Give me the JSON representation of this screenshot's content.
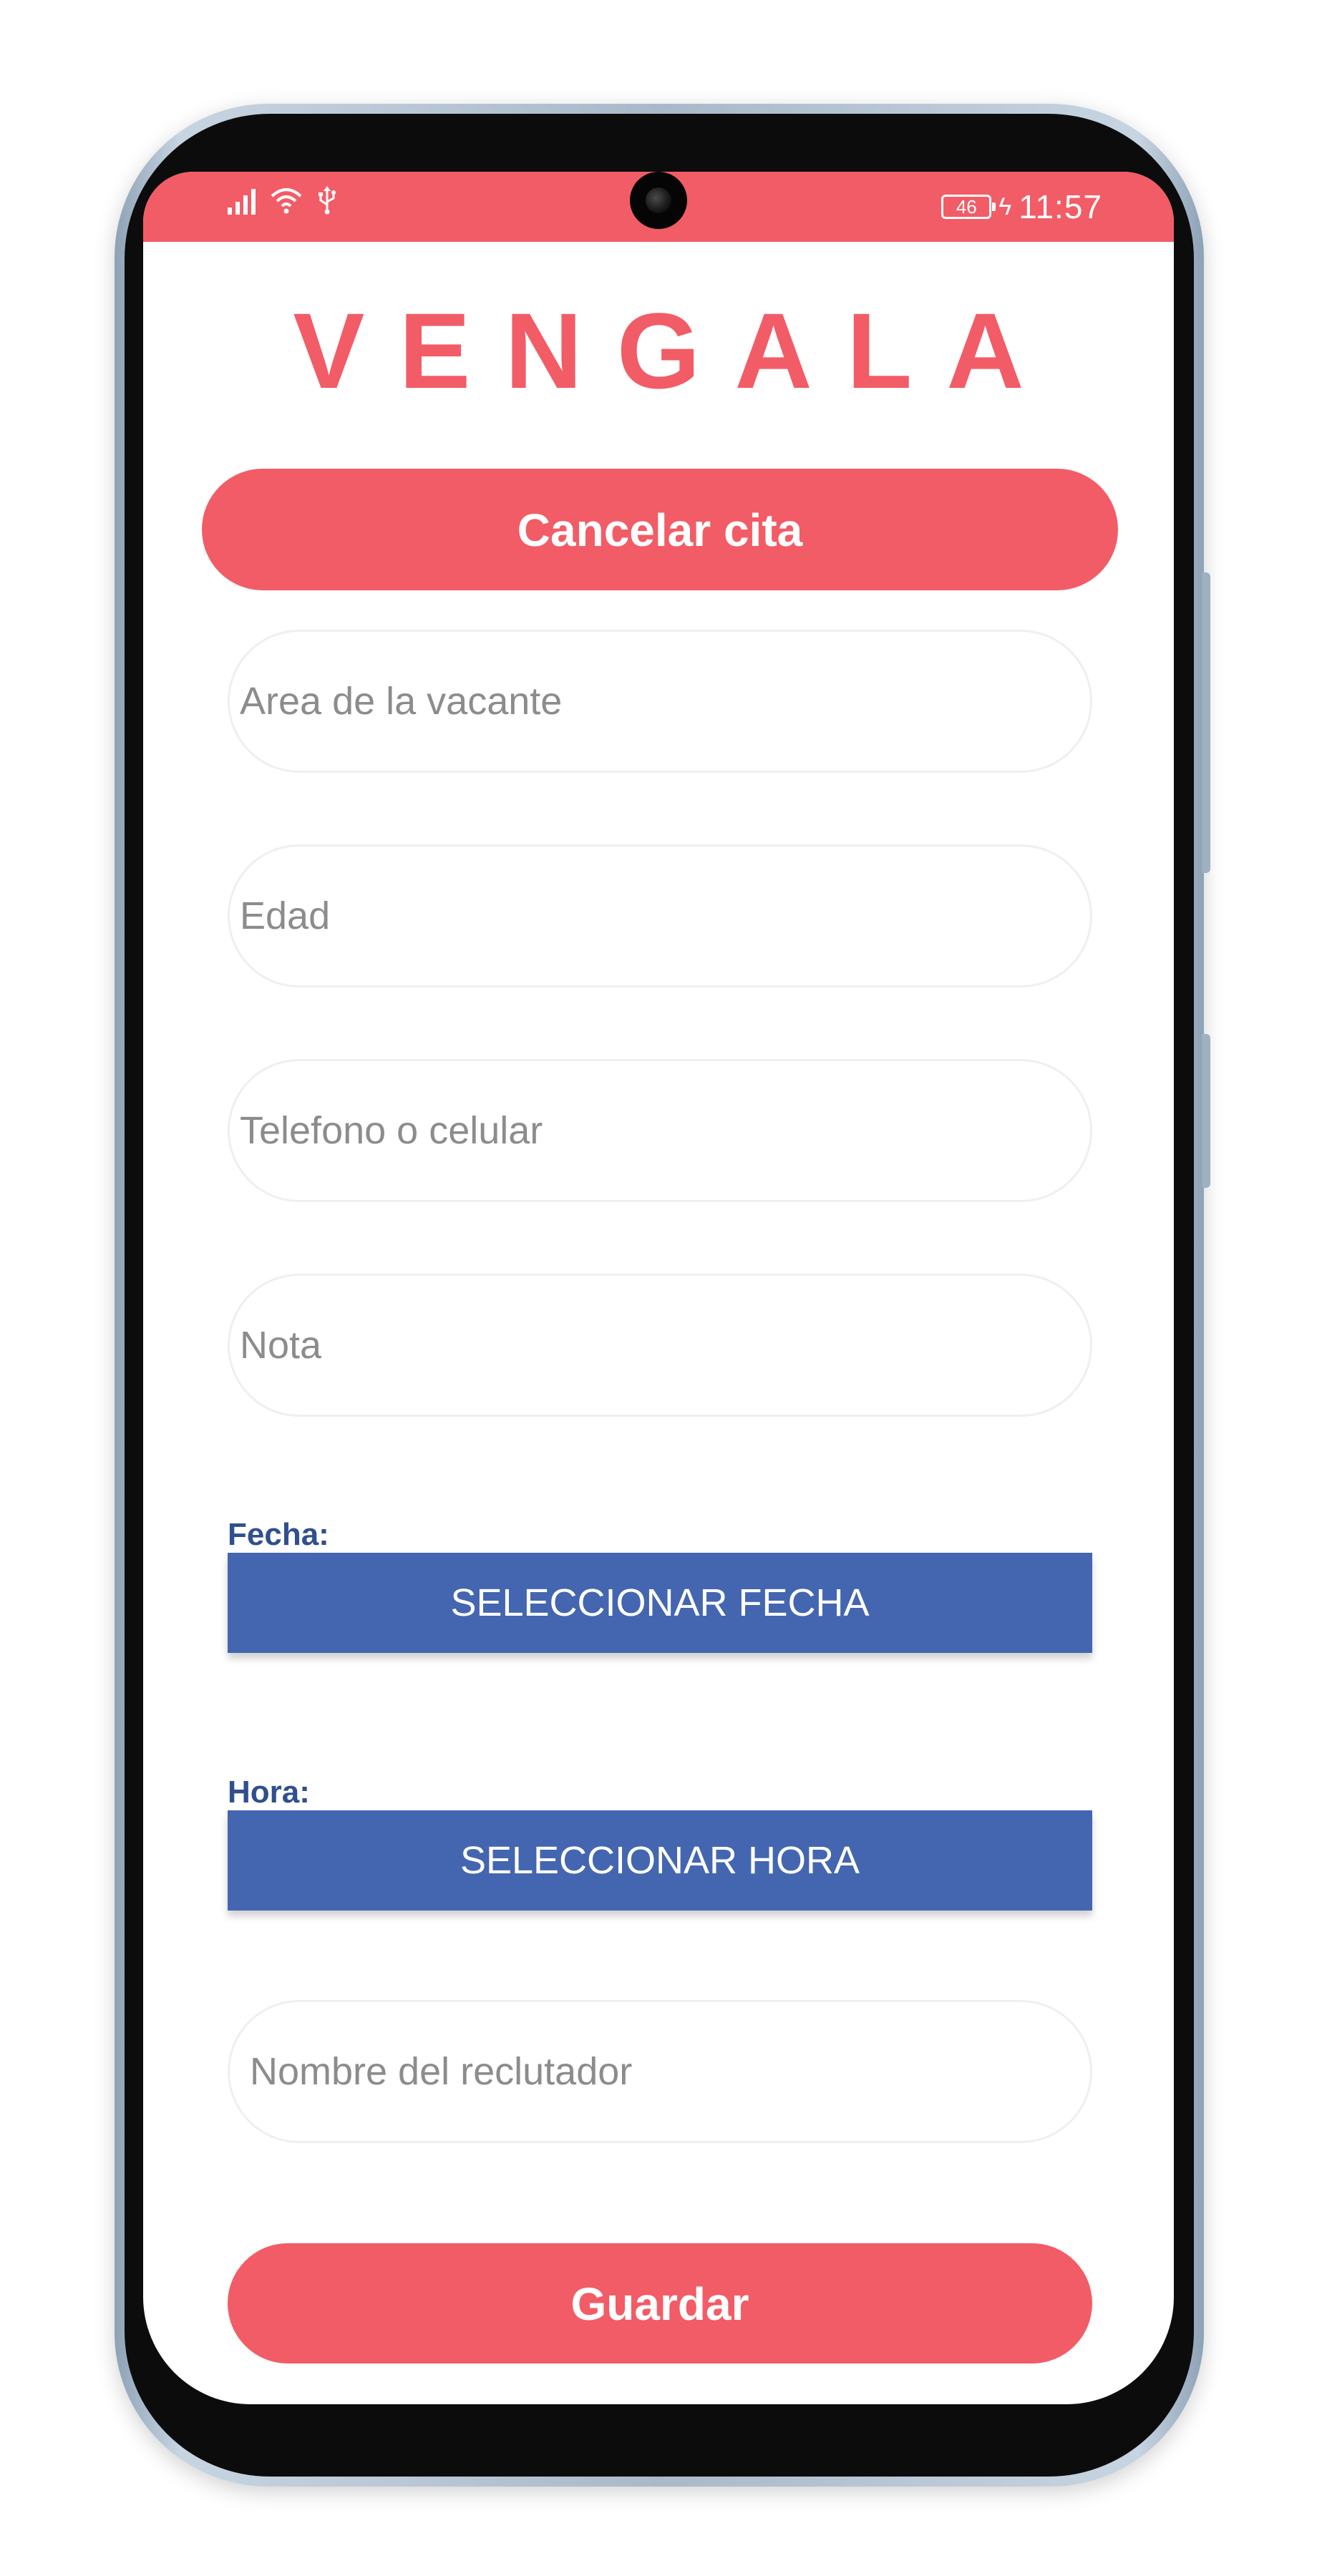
{
  "status_bar": {
    "icons": [
      "signal-icon",
      "wifi-icon",
      "usb-icon",
      "battery-icon",
      "charging-icon"
    ],
    "battery_level": "46",
    "charging_glyph": "ϟ",
    "time": "11:57"
  },
  "app": {
    "title": "VENGALA"
  },
  "cancel_button": {
    "label": "Cancelar cita"
  },
  "form": {
    "area_placeholder": "Area de la vacante",
    "edad_placeholder": "Edad",
    "telefono_placeholder": "Telefono o celular",
    "nota_placeholder": "Nota",
    "fecha_label": "Fecha:",
    "fecha_button": "SELECCIONAR FECHA",
    "hora_label": "Hora:",
    "hora_button": "SELECCIONAR HORA",
    "reclutador_placeholder": "Nombre del reclutador"
  },
  "save_button": {
    "label": "Guardar"
  },
  "colors": {
    "accent": "#f25c66",
    "button_blue": "#4466b0",
    "label_blue": "#2f4f8f",
    "placeholder_gray": "#8c8c8c"
  }
}
